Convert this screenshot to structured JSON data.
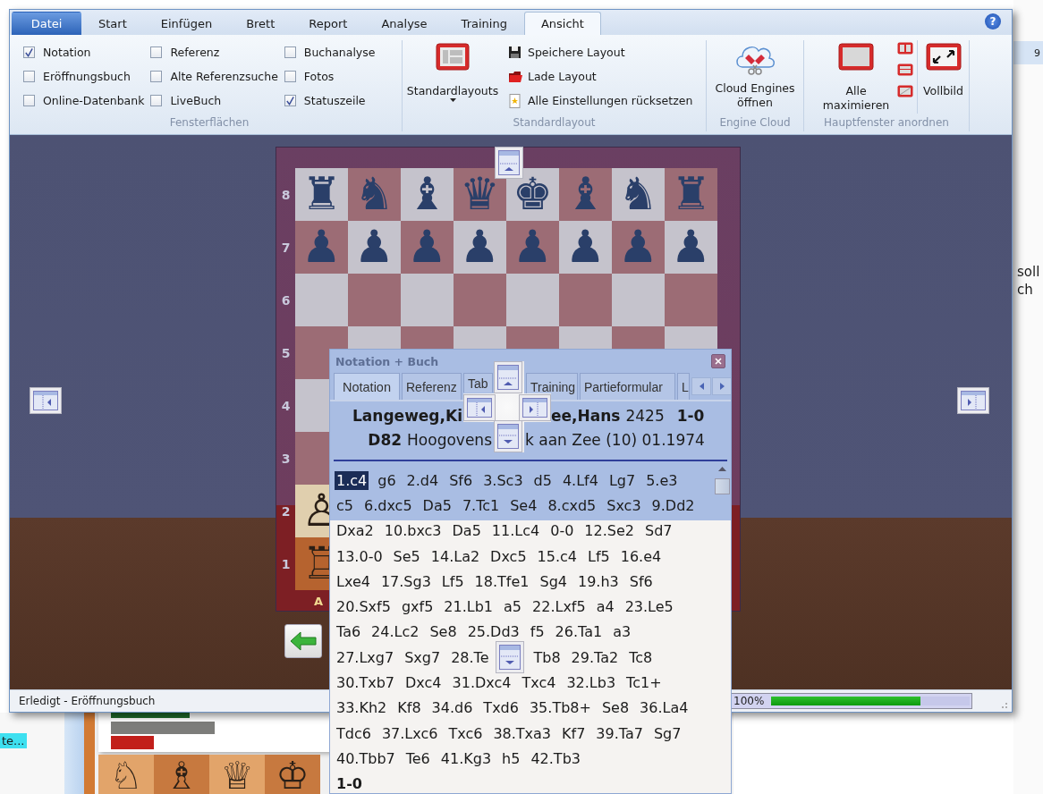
{
  "ribbon_tabs": [
    {
      "label": "Datei",
      "kind": "application",
      "selected": false
    },
    {
      "label": "Start",
      "kind": "tab",
      "selected": false
    },
    {
      "label": "Einfügen",
      "kind": "tab",
      "selected": false
    },
    {
      "label": "Brett",
      "kind": "tab",
      "selected": false
    },
    {
      "label": "Report",
      "kind": "tab",
      "selected": false
    },
    {
      "label": "Analyse",
      "kind": "tab",
      "selected": false
    },
    {
      "label": "Training",
      "kind": "tab",
      "selected": false
    },
    {
      "label": "Ansicht",
      "kind": "tab",
      "selected": true
    }
  ],
  "help_button": "?",
  "ribbon_groups": [
    {
      "kind": "checkboxes",
      "label": "Fensterflächen",
      "columns": [
        [
          {
            "label": "Notation",
            "checked": true
          },
          {
            "label": "Eröffnungsbuch",
            "checked": false
          },
          {
            "label": "Online-Datenbank",
            "checked": false
          }
        ],
        [
          {
            "label": "Referenz",
            "checked": false
          },
          {
            "label": "Alte Referenzsuche",
            "checked": false
          },
          {
            "label": "LiveBuch",
            "checked": false
          }
        ],
        [
          {
            "label": "Buchanalyse",
            "checked": false
          },
          {
            "label": "Fotos",
            "checked": false
          },
          {
            "label": "Statuszeile",
            "checked": true
          }
        ]
      ]
    },
    {
      "kind": "layouts",
      "label": "Standardlayout",
      "large_button": "Standardlayouts",
      "items": [
        "Speichere Layout",
        "Lade Layout",
        "Alle Einstellungen rücksetzen"
      ]
    },
    {
      "kind": "cloud",
      "label": "Engine Cloud",
      "large_button": "Cloud Engines öffnen"
    },
    {
      "kind": "arrange",
      "label": "Hauptfenster anordnen",
      "large_buttons": [
        "Alle maximieren",
        "Vollbild"
      ]
    }
  ],
  "board": {
    "ranks": [
      {
        "label": "8",
        "pieces": "♜♞♝♛♚♝♞♜"
      },
      {
        "label": "7",
        "pieces": "♟♟♟♟♟♟♟♟"
      },
      {
        "label": "6"
      },
      {
        "label": "5"
      },
      {
        "label": "4"
      },
      {
        "label": "3"
      },
      {
        "label": "2",
        "pieces": "♙"
      },
      {
        "label": "1",
        "pieces": "♖"
      }
    ],
    "file_labels": [
      "A"
    ]
  },
  "status_bar": {
    "text": "Erledigt - Eröffnungsbuch",
    "progress_label": "100%",
    "level": 0.75
  },
  "notation_panel": {
    "title": "Notation + Buch",
    "tabs": [
      {
        "label": "Notation",
        "selected": true
      },
      {
        "label": "Referenz",
        "selected": false
      },
      {
        "label": "Tab",
        "selected": false
      },
      {
        "label": "Training",
        "selected": false
      },
      {
        "label": "Partieformular",
        "selected": false
      },
      {
        "label": "L",
        "selected": false
      }
    ],
    "header": {
      "players_left": "Langeweg,Ki",
      "players_right": "ee,Hans",
      "elo": "2425",
      "result": "1-0",
      "eco": "D82",
      "event_left": "Hoogovens",
      "event_right": "k aan Zee (10) 01.1974"
    },
    "moves": [
      [
        {
          "move": "1.c4",
          "selected": true
        },
        {
          "move": "g6",
          "selected": false
        },
        {
          "move": "2.d4",
          "selected": false
        },
        {
          "move": "Sf6",
          "selected": false
        },
        {
          "move": "3.Sc3",
          "selected": false
        },
        {
          "move": "d5",
          "selected": false
        },
        {
          "move": "4.Lf4",
          "selected": false
        },
        {
          "move": "Lg7",
          "selected": false
        },
        {
          "move": "5.e3",
          "selected": false
        }
      ],
      [
        {
          "move": "c5",
          "selected": false
        },
        {
          "move": "6.dxc5",
          "selected": false
        },
        {
          "move": "Da5",
          "selected": false
        },
        {
          "move": "7.Tc1",
          "selected": false
        },
        {
          "move": "Se4",
          "selected": false
        },
        {
          "move": "8.cxd5",
          "selected": false
        },
        {
          "move": "Sxc3",
          "selected": false
        },
        {
          "move": "9.Dd2",
          "selected": false
        }
      ],
      [
        {
          "move": "Dxa2",
          "selected": false
        },
        {
          "move": "10.bxc3",
          "selected": false
        },
        {
          "move": "Da5",
          "selected": false
        },
        {
          "move": "11.Lc4",
          "selected": false
        },
        {
          "move": "0-0",
          "selected": false
        },
        {
          "move": "12.Se2",
          "selected": false
        },
        {
          "move": "Sd7",
          "selected": false
        }
      ],
      [
        {
          "move": "13.0-0",
          "selected": false
        },
        {
          "move": "Se5",
          "selected": false
        },
        {
          "move": "14.La2",
          "selected": false
        },
        {
          "move": "Dxc5",
          "selected": false
        },
        {
          "move": "15.c4",
          "selected": false
        },
        {
          "move": "Lf5",
          "selected": false
        },
        {
          "move": "16.e4",
          "selected": false
        }
      ],
      [
        {
          "move": "Lxe4",
          "selected": false
        },
        {
          "move": "17.Sg3",
          "selected": false
        },
        {
          "move": "Lf5",
          "selected": false
        },
        {
          "move": "18.Tfe1",
          "selected": false
        },
        {
          "move": "Sg4",
          "selected": false
        },
        {
          "move": "19.h3",
          "selected": false
        },
        {
          "move": "Sf6",
          "selected": false
        }
      ],
      [
        {
          "move": "20.Sxf5",
          "selected": false
        },
        {
          "move": "gxf5",
          "selected": false
        },
        {
          "move": "21.Lb1",
          "selected": false
        },
        {
          "move": "a5",
          "selected": false
        },
        {
          "move": "22.Lxf5",
          "selected": false
        },
        {
          "move": "a4",
          "selected": false
        },
        {
          "move": "23.Le5",
          "selected": false
        }
      ],
      [
        {
          "move": "Ta6",
          "selected": false
        },
        {
          "move": "24.Lc2",
          "selected": false
        },
        {
          "move": "Se8",
          "selected": false
        },
        {
          "move": "25.Dd3",
          "selected": false
        },
        {
          "move": "f5",
          "selected": false
        },
        {
          "move": "26.Ta1",
          "selected": false
        },
        {
          "move": "a3",
          "selected": false
        }
      ],
      [
        {
          "move": "27.Lxg7",
          "selected": false
        },
        {
          "move": "Sxg7",
          "selected": false
        },
        {
          "move": "28.Te",
          "selected": false,
          "guide_after": true
        },
        {
          "move": "Tb8",
          "selected": false
        },
        {
          "move": "29.Ta2",
          "selected": false
        },
        {
          "move": "Tc8",
          "selected": false
        }
      ],
      [
        {
          "move": "30.Txb7",
          "selected": false
        },
        {
          "move": "Dxc4",
          "selected": false
        },
        {
          "move": "31.Dxc4",
          "selected": false
        },
        {
          "move": "Txc4",
          "selected": false
        },
        {
          "move": "32.Lb3",
          "selected": false
        },
        {
          "move": "Tc1+",
          "selected": false
        }
      ],
      [
        {
          "move": "33.Kh2",
          "selected": false
        },
        {
          "move": "Kf8",
          "selected": false
        },
        {
          "move": "34.d6",
          "selected": false
        },
        {
          "move": "Txd6",
          "selected": false
        },
        {
          "move": "35.Tb8+",
          "selected": false
        },
        {
          "move": "Se8",
          "selected": false
        },
        {
          "move": "36.La4",
          "selected": false
        }
      ],
      [
        {
          "move": "Tdc6",
          "selected": false
        },
        {
          "move": "37.Lxc6",
          "selected": false
        },
        {
          "move": "Txc6",
          "selected": false
        },
        {
          "move": "38.Txa3",
          "selected": false
        },
        {
          "move": "Kf7",
          "selected": false
        },
        {
          "move": "39.Ta7",
          "selected": false
        },
        {
          "move": "Sg7",
          "selected": false
        }
      ],
      [
        {
          "move": "40.Tbb7",
          "selected": false
        },
        {
          "move": "Te6",
          "selected": false
        },
        {
          "move": "41.Kg3",
          "selected": false
        },
        {
          "move": "h5",
          "selected": false
        },
        {
          "move": "42.Tb3",
          "selected": false
        }
      ]
    ],
    "result": "1-0"
  },
  "background": {
    "right_texts": [
      "9",
      "soll",
      "ch"
    ],
    "lower_window": {
      "label": "te...",
      "pieces": [
        "♘",
        "♗",
        "♕",
        "♔"
      ]
    }
  }
}
